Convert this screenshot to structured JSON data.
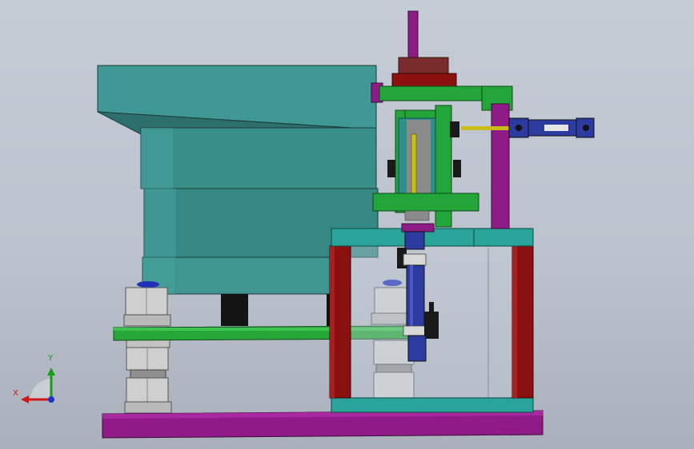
{
  "window": {
    "background": "#c0c7d2"
  },
  "triad": {
    "x_label": "X",
    "y_label": "Y",
    "x_color": "#d11818",
    "y_color": "#15a015",
    "z_color": "#1d34c8"
  },
  "model": {
    "bowl_color": "#3e9792",
    "frame_green": "#24a53a",
    "frame_teal": "#2aa39a",
    "frame_red": "#8b1010",
    "frame_purple": "#8f1b86",
    "cylinder_blue": "#2d3aa0",
    "nut_color": "#c8c8c8"
  }
}
